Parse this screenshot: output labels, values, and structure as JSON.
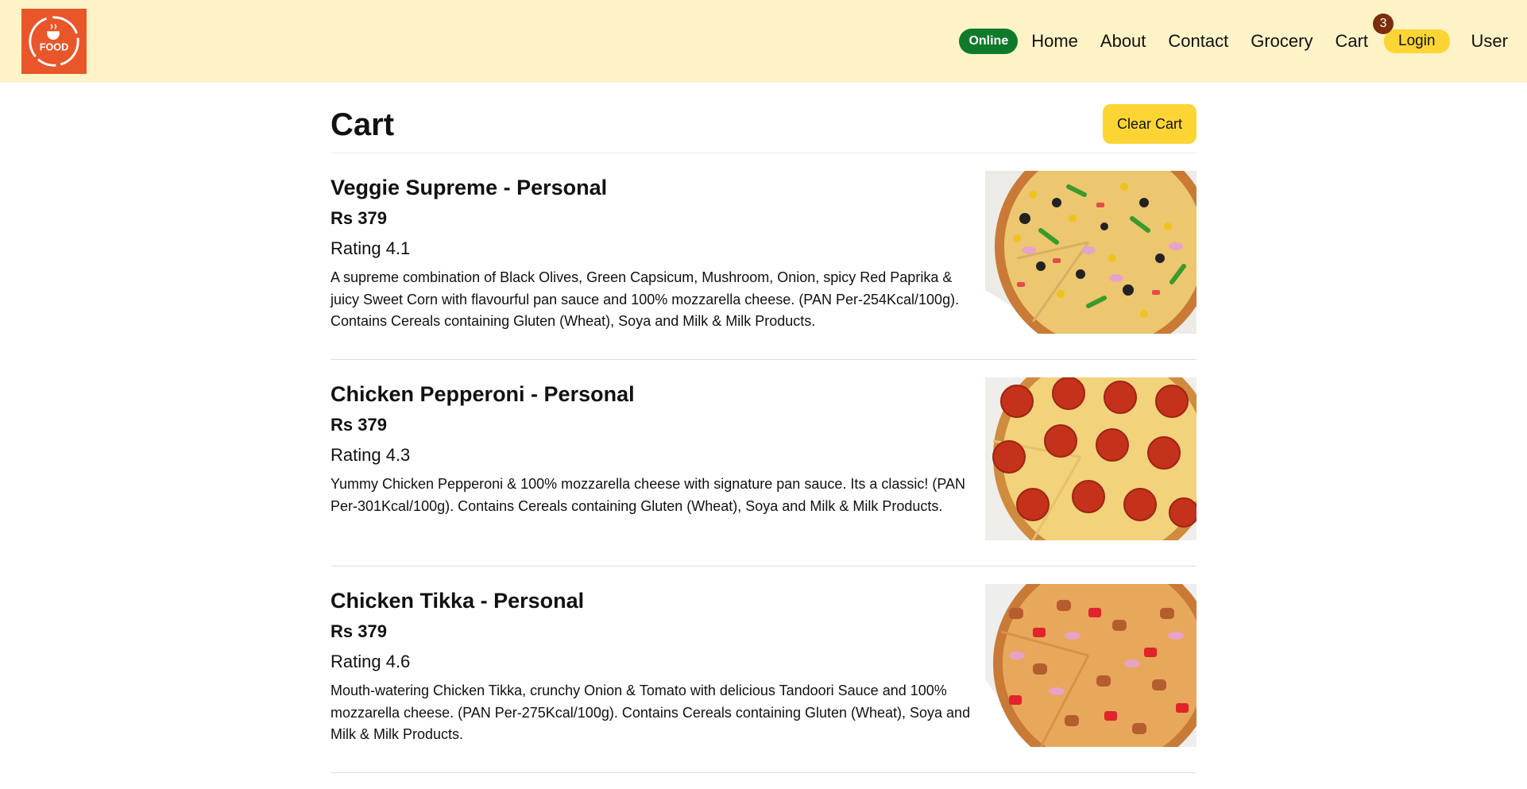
{
  "header": {
    "logo_text": "FOOD",
    "status_badge": "Online",
    "nav": {
      "home": "Home",
      "about": "About",
      "contact": "Contact",
      "grocery": "Grocery",
      "cart": "Cart",
      "cart_count": "3",
      "login": "Login",
      "user": "User"
    }
  },
  "cart": {
    "title": "Cart",
    "clear_label": "Clear Cart",
    "items": [
      {
        "name": "Veggie Supreme - Personal",
        "price": "Rs 379",
        "rating": "Rating 4.1",
        "description": "A supreme combination of Black Olives, Green Capsicum, Mushroom, Onion, spicy Red Paprika & juicy Sweet Corn with flavourful pan sauce and 100% mozzarella cheese. (PAN Per-254Kcal/100g). Contains Cereals containing Gluten (Wheat), Soya and Milk & Milk Products.",
        "image": "veggie-supreme-pizza-photo"
      },
      {
        "name": "Chicken Pepperoni - Personal",
        "price": "Rs 379",
        "rating": "Rating 4.3",
        "description": "Yummy Chicken Pepperoni & 100% mozzarella cheese with signature pan sauce. Its a classic! (PAN Per-301Kcal/100g). Contains Cereals containing Gluten (Wheat), Soya and Milk & Milk Products.",
        "image": "chicken-pepperoni-pizza-photo"
      },
      {
        "name": "Chicken Tikka - Personal",
        "price": "Rs 379",
        "rating": "Rating 4.6",
        "description": "Mouth-watering Chicken Tikka, crunchy Onion & Tomato with delicious Tandoori Sauce and 100% mozzarella cheese. (PAN Per-275Kcal/100g). Contains Cereals containing Gluten (Wheat), Soya and Milk & Milk Products.",
        "image": "chicken-tikka-pizza-photo"
      }
    ]
  },
  "colors": {
    "header_bg": "#fef3c7",
    "logo_bg": "#e8562a",
    "online_badge": "#0f7a2a",
    "accent_yellow": "#fcd535",
    "cart_count_bg": "#7a2e0c"
  }
}
